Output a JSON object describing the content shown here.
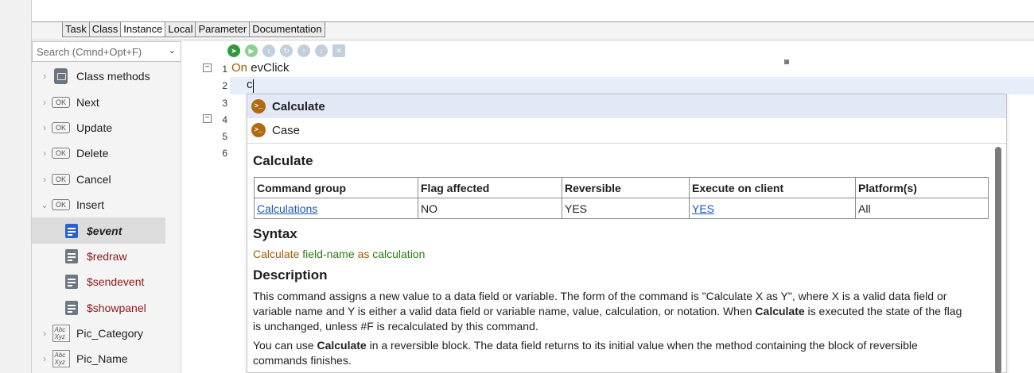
{
  "tabs": [
    "Task",
    "Class",
    "Instance",
    "Local",
    "Parameter",
    "Documentation"
  ],
  "active_tab": "Instance",
  "search": {
    "placeholder": "Search (Cmnd+Opt+F)"
  },
  "tree": {
    "class_methods": "Class methods",
    "ok_items": [
      "Next",
      "Update",
      "Delete",
      "Cancel",
      "Insert"
    ],
    "ok_icon_text": "OK",
    "children": [
      "$event",
      "$redraw",
      "$sendevent",
      "$showpanel"
    ],
    "abc_icon_text": [
      "Abc",
      "Xyz"
    ],
    "fields": [
      "Pic_Category",
      "Pic_Name"
    ]
  },
  "editor": {
    "line_numbers": [
      "1",
      "2",
      "3",
      "4",
      "5",
      "6"
    ],
    "line1_keyword": "On",
    "line1_rest": "evClick",
    "line2_text": "c"
  },
  "autocomplete": {
    "items": [
      "Calculate",
      "Case"
    ],
    "icon_glyph": ">_"
  },
  "help": {
    "title": "Calculate",
    "table_headers": [
      "Command group",
      "Flag affected",
      "Reversible",
      "Execute on client",
      "Platform(s)"
    ],
    "table_row": [
      "Calculations",
      "NO",
      "YES",
      "YES",
      "All"
    ],
    "syntax_heading": "Syntax",
    "syntax": {
      "kw1": "Calculate",
      "arg1": "field-name",
      "kw2": "as",
      "arg2": "calculation"
    },
    "description_heading": "Description",
    "desc1_a": "This command assigns a new value to a data field or variable. The form of the command is \"Calculate X as Y\", where X is a valid data field or variable name and Y is either a valid data field or variable name, value, calculation, or notation. When ",
    "desc1_bold": "Calculate",
    "desc1_b": " is executed the state of the flag is unchanged, unless #F is recalculated by this command.",
    "desc2_a": "You can use ",
    "desc2_bold": "Calculate",
    "desc2_b": " in a reversible block. The data field returns to its initial value when the method containing the block of reversible commands finishes."
  },
  "colors": {
    "doc_icon_blue": "#2d5fd0",
    "doc_icon_grey": "#6f7782",
    "keyword": "#a05a00",
    "syntax_arg": "#2b7a16",
    "link": "#1a56c9"
  }
}
